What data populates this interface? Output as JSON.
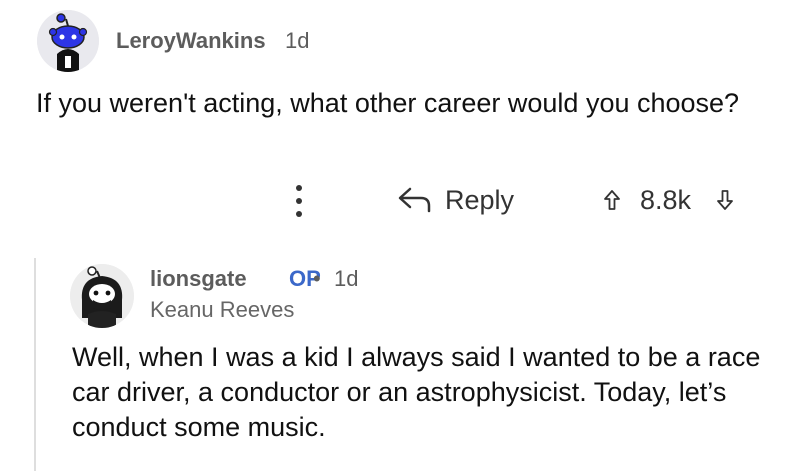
{
  "top_comment": {
    "username": "LeroyWankins",
    "age": "1d",
    "body": "If you weren't acting, what other career would you choose?",
    "avatar_icon": "snoo-avatar-icon"
  },
  "actions": {
    "more_icon": "more-vertical-icon",
    "reply_label": "Reply",
    "reply_icon": "reply-arrow-icon",
    "score": "8.8k",
    "upvote_icon": "upvote-icon",
    "downvote_icon": "downvote-icon"
  },
  "reply_comment": {
    "username": "lionsgate",
    "op_badge": "OP",
    "separator": "•",
    "age": "1d",
    "flair": "Keanu Reeves",
    "body": "Well, when I was a kid I always said I wanted to be a race car driver, a conductor or an astrophysicist. Today, let’s conduct some music.",
    "avatar_icon": "snoo-avatar-icon"
  },
  "colors": {
    "op_badge": "#3b68c9",
    "meta_text": "#5c5c5c",
    "thread_line": "#dedede",
    "avatar_top": "#2d35e6"
  }
}
